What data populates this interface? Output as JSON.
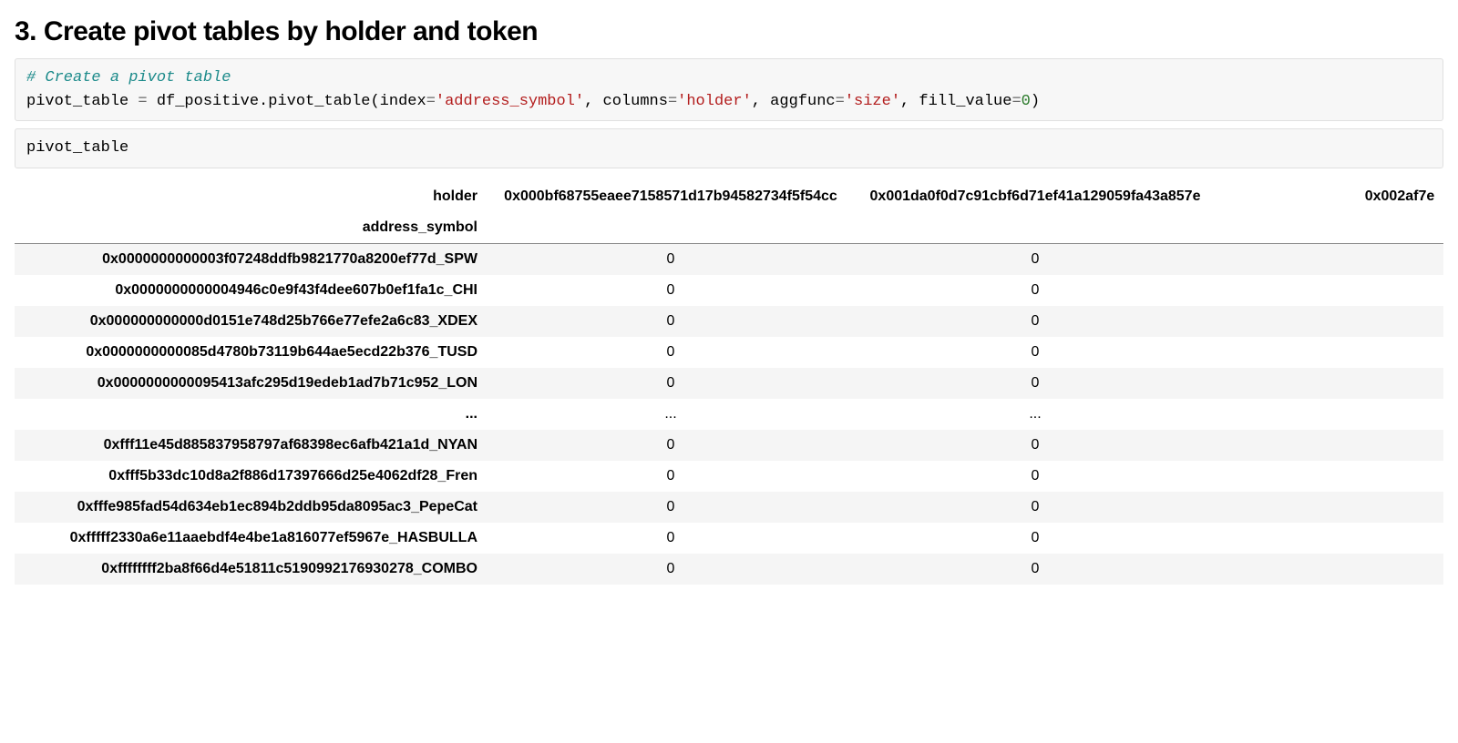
{
  "heading": "3. Create pivot tables by holder and token",
  "code1": {
    "comment": "# Create a pivot table",
    "line_pre": "pivot_table ",
    "eq": "=",
    "mid": " df_positive.pivot_table(index",
    "arg1": "'address_symbol'",
    "c1": ", columns",
    "arg2": "'holder'",
    "c2": ", aggfunc",
    "arg3": "'size'",
    "c3": ", fill_value",
    "arg4": "0",
    "close": ")"
  },
  "code2": "pivot_table",
  "table": {
    "columns_name": "holder",
    "index_name": "address_symbol",
    "columns": [
      "0x000bf68755eaee7158571d17b94582734f5f54cc",
      "0x001da0f0d7c91cbf6d71ef41a129059fa43a857e",
      "0x002af7e"
    ],
    "rows": [
      {
        "index": "0x0000000000003f07248ddfb9821770a8200ef77d_SPW",
        "values": [
          "0",
          "0"
        ]
      },
      {
        "index": "0x0000000000004946c0e9f43f4dee607b0ef1fa1c_CHI",
        "values": [
          "0",
          "0"
        ]
      },
      {
        "index": "0x000000000000d0151e748d25b766e77efe2a6c83_XDEX",
        "values": [
          "0",
          "0"
        ]
      },
      {
        "index": "0x0000000000085d4780b73119b644ae5ecd22b376_TUSD",
        "values": [
          "0",
          "0"
        ]
      },
      {
        "index": "0x0000000000095413afc295d19edeb1ad7b71c952_LON",
        "values": [
          "0",
          "0"
        ]
      },
      {
        "index": "...",
        "values": [
          "...",
          "..."
        ]
      },
      {
        "index": "0xfff11e45d885837958797af68398ec6afb421a1d_NYAN",
        "values": [
          "0",
          "0"
        ]
      },
      {
        "index": "0xfff5b33dc10d8a2f886d17397666d25e4062df28_Fren",
        "values": [
          "0",
          "0"
        ]
      },
      {
        "index": "0xfffe985fad54d634eb1ec894b2ddb95da8095ac3_PepeCat",
        "values": [
          "0",
          "0"
        ]
      },
      {
        "index": "0xfffff2330a6e11aaebdf4e4be1a816077ef5967e_HASBULLA",
        "values": [
          "0",
          "0"
        ]
      },
      {
        "index": "0xffffffff2ba8f66d4e51811c5190992176930278_COMBO",
        "values": [
          "0",
          "0"
        ]
      }
    ]
  }
}
